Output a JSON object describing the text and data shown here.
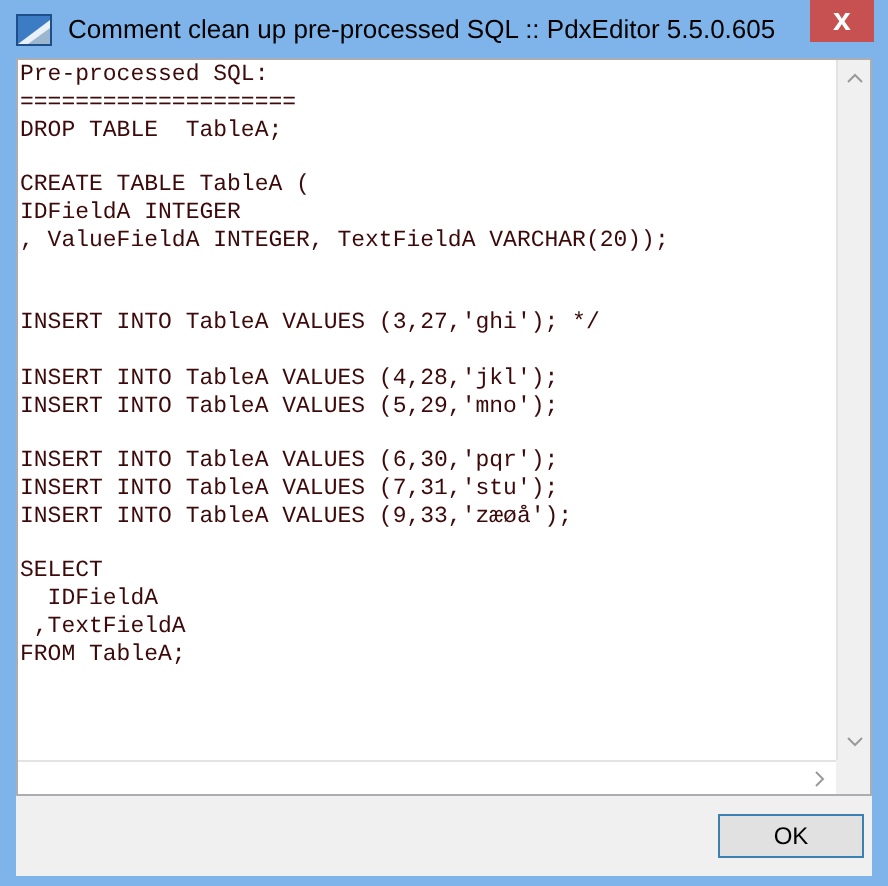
{
  "window": {
    "title": "Comment clean up pre-processed SQL :: PdxEditor 5.5.0.605",
    "close_label": "x"
  },
  "editor": {
    "lines": [
      {
        "kind": "code",
        "text": "Pre-processed SQL:"
      },
      {
        "kind": "code",
        "text": "===================="
      },
      {
        "kind": "code",
        "text": "DROP TABLE  TableA;"
      },
      {
        "kind": "blank"
      },
      {
        "kind": "code",
        "text": "CREATE TABLE TableA ("
      },
      {
        "kind": "code",
        "text": "IDFieldA INTEGER"
      },
      {
        "kind": "code",
        "text": ", ValueFieldA INTEGER, TextFieldA VARCHAR(20));"
      },
      {
        "kind": "blank"
      },
      {
        "kind": "blank"
      },
      {
        "kind": "code",
        "text": "INSERT INTO TableA VALUES (3,27,'ghi'); */"
      },
      {
        "kind": "blank"
      },
      {
        "kind": "code",
        "text": "INSERT INTO TableA VALUES (4,28,'jkl');"
      },
      {
        "kind": "code",
        "text": "INSERT INTO TableA VALUES (5,29,'mno');"
      },
      {
        "kind": "blank"
      },
      {
        "kind": "code",
        "text": "INSERT INTO TableA VALUES (6,30,'pqr');"
      },
      {
        "kind": "code",
        "text": "INSERT INTO TableA VALUES (7,31,'stu');"
      },
      {
        "kind": "code",
        "text": "INSERT INTO TableA VALUES (9,33,'zæøå');"
      },
      {
        "kind": "blank"
      },
      {
        "kind": "code",
        "text": "SELECT"
      },
      {
        "kind": "code",
        "text": "  IDFieldA"
      },
      {
        "kind": "code",
        "text": " ,TextFieldA"
      },
      {
        "kind": "code",
        "text": "FROM TableA;"
      }
    ]
  },
  "buttons": [
    {
      "label": "OK"
    }
  ]
}
